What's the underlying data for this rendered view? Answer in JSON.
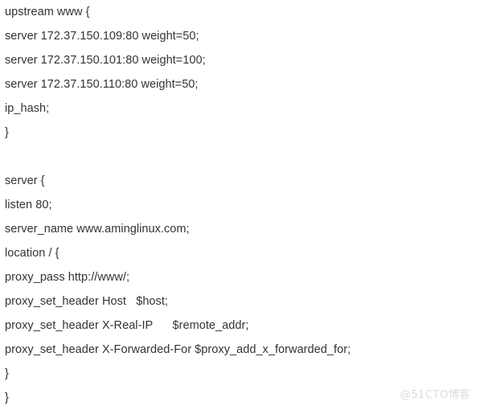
{
  "page": {
    "background_color": "#ffffff",
    "text_color": "#333333",
    "document_type": "nginx configuration snippet"
  },
  "code": {
    "language": "nginx",
    "lines": [
      "upstream www {",
      "server 172.37.150.109:80 weight=50;",
      "server 172.37.150.101:80 weight=100;",
      "server 172.37.150.110:80 weight=50;",
      "ip_hash;",
      "}",
      "",
      "server {",
      "listen 80;",
      "server_name www.aminglinux.com;",
      "location / {",
      "proxy_pass http://www/;",
      "proxy_set_header Host   $host;",
      "proxy_set_header X-Real-IP      $remote_addr;",
      "proxy_set_header X-Forwarded-For $proxy_add_x_forwarded_for;",
      "}",
      "}"
    ]
  },
  "watermark": {
    "text": "@51CTO博客",
    "color": "#dcdcdc"
  }
}
